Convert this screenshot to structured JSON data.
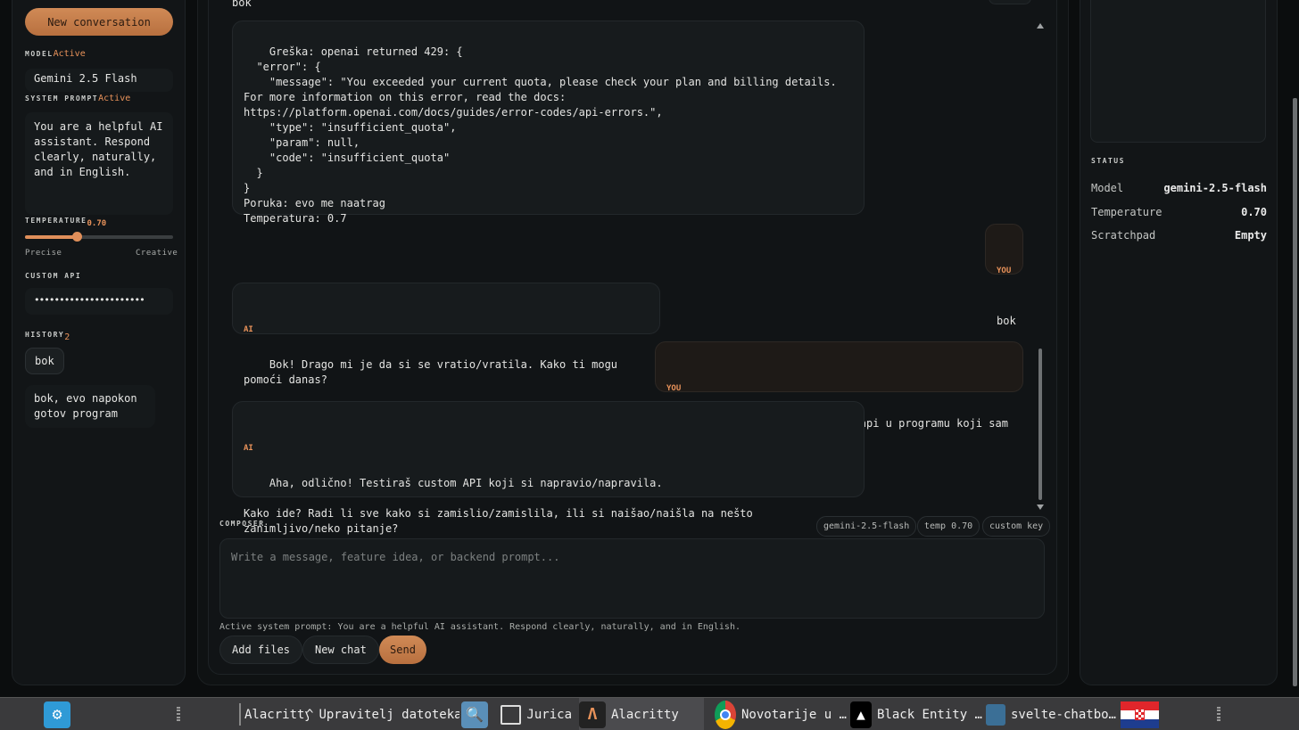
{
  "sidebar": {
    "new_conversation": "New conversation",
    "model_label": "MODEL",
    "model_tag": "Active",
    "model_value": "Gemini 2.5 Flash",
    "system_prompt_label": "SYSTEM PROMPT",
    "system_prompt_tag": "Active",
    "system_prompt_value": "You are a helpful AI assistant. Respond clearly, naturally, and in English.",
    "temperature_label": "TEMPERATURE",
    "temperature_value": "0.70",
    "temperature_fraction": 0.35,
    "precise": "Precise",
    "creative": "Creative",
    "custom_api_label": "CUSTOM API",
    "custom_api_value": "••••••••••••••••••••••",
    "history_label": "HISTORY",
    "history_count": "2",
    "history": [
      "bok",
      "bok, evo napokon gotov program"
    ]
  },
  "chat": {
    "top_partial": "bok",
    "messages": [
      {
        "role": "",
        "text": "Greška: openai returned 429: {\n  \"error\": {\n    \"message\": \"You exceeded your current quota, please check your plan and billing details. For more information on this error, read the docs: https://platform.openai.com/docs/guides/error-codes/api-errors.\",\n    \"type\": \"insufficient_quota\",\n    \"param\": null,\n    \"code\": \"insufficient_quota\"\n  }\n}\nPoruka: evo me naatrag\nTemperatura: 0.7"
      },
      {
        "role": "YOU",
        "text": "bok"
      },
      {
        "role": "AI",
        "text": "Bok! Drago mi je da si se vratio/vratila. Kako ti mogu pomoći danas?"
      },
      {
        "role": "YOU",
        "text": "ma gledam jel radi custom api u programu koji sam napravil"
      },
      {
        "role": "AI",
        "text": "Aha, odlično! Testiraš custom API koji si napravio/napravila.\n\nKako ide? Radi li sve kako si zamislio/zamislila, ili si naišao/naišla na nešto zanimljivo/neko pitanje?"
      }
    ]
  },
  "composer": {
    "label": "COMPOSER",
    "chips": [
      "gemini-2.5-flash",
      "temp 0.70",
      "custom key"
    ],
    "placeholder": "Write a message, feature idea, or backend prompt...",
    "active_prompt": "Active system prompt: You are a helpful AI assistant. Respond clearly, naturally, and in English.",
    "add_files": "Add files",
    "new_chat": "New chat",
    "send": "Send"
  },
  "status": {
    "label": "STATUS",
    "rows": [
      {
        "key": "Model",
        "value": "gemini-2.5-flash"
      },
      {
        "key": "Temperature",
        "value": "0.70"
      },
      {
        "key": "Scratchpad",
        "value": "Empty"
      }
    ]
  },
  "taskbar": {
    "items": [
      "Alacritty",
      "Upravitelj datotekama",
      "Jurica",
      "Alacritty",
      "Novotarije u …",
      "Black Entity …",
      "svelte-chatbo…"
    ]
  },
  "colors": {
    "accent": "#e08f5a",
    "background": "#0b0d0e",
    "panel": "#121517"
  }
}
